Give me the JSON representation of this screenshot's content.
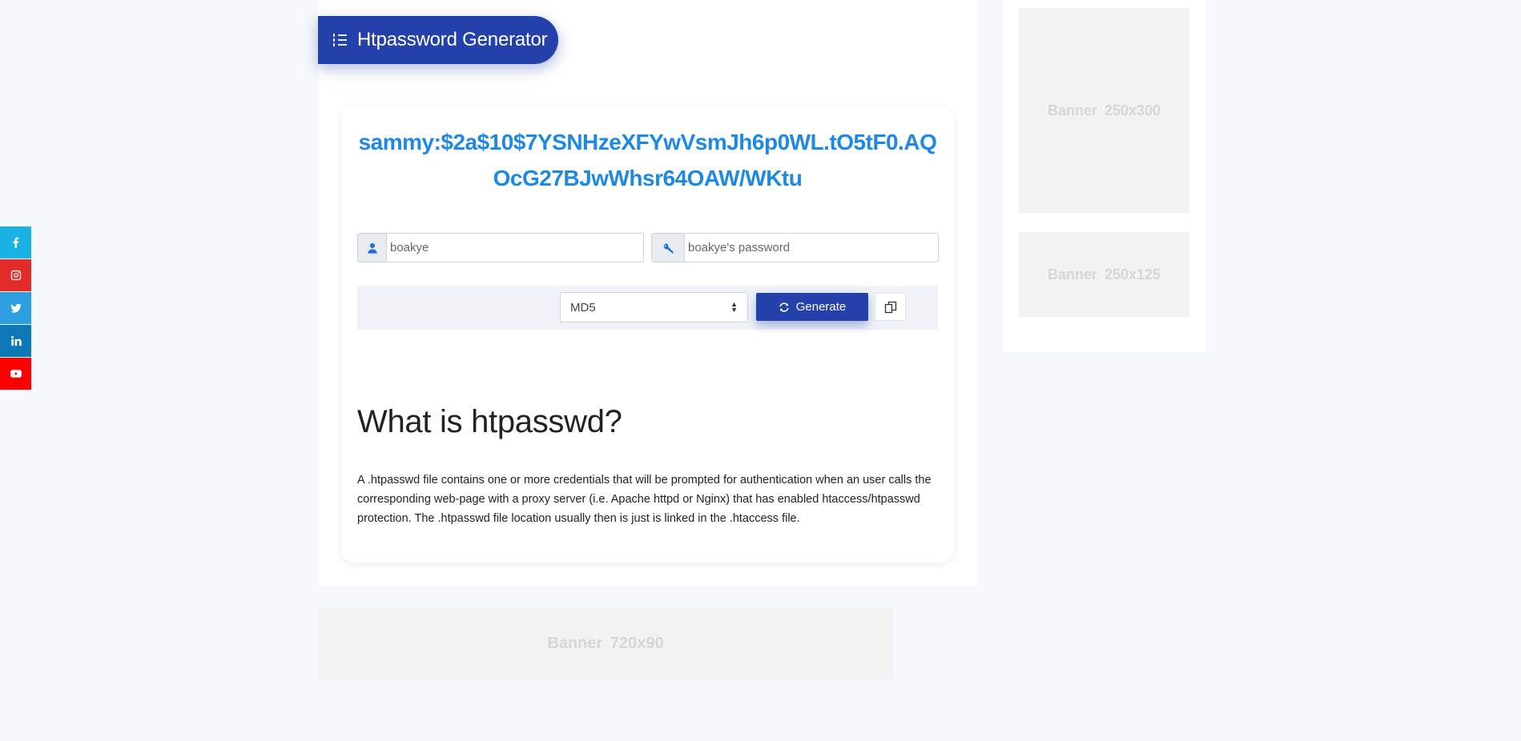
{
  "app": {
    "title": "Htpassword Generator"
  },
  "social": [
    {
      "name": "facebook",
      "icon": "facebook-icon",
      "color": "#1ab1e4"
    },
    {
      "name": "instagram",
      "icon": "instagram-icon",
      "color": "#e22b2b"
    },
    {
      "name": "twitter",
      "icon": "twitter-icon",
      "color": "#2d9fe0"
    },
    {
      "name": "linkedin",
      "icon": "linkedin-icon",
      "color": "#0c78b5"
    },
    {
      "name": "youtube",
      "icon": "youtube-icon",
      "color": "#ff0000"
    }
  ],
  "result": {
    "text": "sammy:$2a$10$7YSNHzeXFYwVsmJh6p0WL.tO5tF0.AQOcG27BJwWhsr64OAW/WKtu"
  },
  "form": {
    "username": {
      "value": "",
      "placeholder": "boakye"
    },
    "password": {
      "value": "",
      "placeholder": "boakye's password"
    },
    "algorithm": {
      "selected": "MD5"
    },
    "generate_label": "Generate"
  },
  "content": {
    "heading": "What is htpasswd?",
    "paragraph": "A .htpasswd file contains one or more credentials that will be prompted for authentication when an user calls the corresponding web-page with a proxy server (i.e. Apache httpd or Nginx) that has enabled htaccess/htpasswd protection. The .htpasswd file location usually then is just is linked in the .htaccess file."
  },
  "banners": {
    "side_top": "Banner  250x300",
    "side_bottom": "Banner  250x125",
    "bottom": "Banner  720x90"
  },
  "colors": {
    "accent": "#2340ab",
    "result_text": "#1e88e5",
    "page_bg": "#f5f8fd"
  }
}
